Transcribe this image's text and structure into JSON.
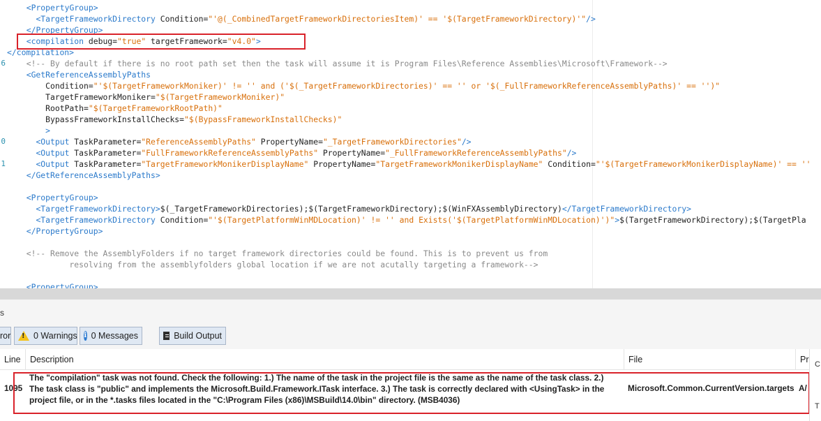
{
  "editor": {
    "gutter_digits": [
      "",
      "",
      "",
      "",
      "",
      "6",
      "",
      "",
      "",
      "",
      "",
      "",
      "0",
      "",
      "1",
      "",
      "",
      "",
      "",
      "",
      "",
      "",
      "",
      "",
      "",
      "",
      ""
    ],
    "lines": [
      [
        {
          "t": "  ",
          "c": "text"
        },
        {
          "t": "<",
          "c": "bracket"
        },
        {
          "t": "PropertyGroup",
          "c": "tag"
        },
        {
          "t": ">",
          "c": "bracket"
        }
      ],
      [
        {
          "t": "    ",
          "c": "text"
        },
        {
          "t": "<",
          "c": "bracket"
        },
        {
          "t": "TargetFrameworkDirectory",
          "c": "tag"
        },
        {
          "t": " Condition",
          "c": "attr"
        },
        {
          "t": "=",
          "c": "eq"
        },
        {
          "t": "\"'@(_CombinedTargetFrameworkDirectoriesItem)' == '$(TargetFrameworkDirectory)'\"",
          "c": "val"
        },
        {
          "t": "/>",
          "c": "bracket"
        }
      ],
      [
        {
          "t": "  ",
          "c": "text"
        },
        {
          "t": "</",
          "c": "bracket"
        },
        {
          "t": "PropertyGroup",
          "c": "tag"
        },
        {
          "t": ">",
          "c": "bracket"
        }
      ],
      [
        {
          "t": "  ",
          "c": "text"
        },
        {
          "t": "<",
          "c": "bracket"
        },
        {
          "t": "compilation",
          "c": "tag"
        },
        {
          "t": " debug",
          "c": "attr"
        },
        {
          "t": "=",
          "c": "eq"
        },
        {
          "t": "\"true\"",
          "c": "val"
        },
        {
          "t": " targetFramework",
          "c": "attr"
        },
        {
          "t": "=",
          "c": "eq"
        },
        {
          "t": "\"v4.0\"",
          "c": "val"
        },
        {
          "t": ">",
          "c": "bracket"
        }
      ],
      [
        {
          "t": "</",
          "c": "bracket"
        },
        {
          "t": "compilation",
          "c": "tag"
        },
        {
          "t": ">",
          "c": "bracket"
        }
      ],
      [
        {
          "t": "  ",
          "c": "text"
        },
        {
          "t": "<!-- By default if there is no root path set then the task will assume it is Program Files\\Reference Assemblies\\Microsoft\\Framework-->",
          "c": "comment"
        }
      ],
      [
        {
          "t": "  ",
          "c": "text"
        },
        {
          "t": "<",
          "c": "bracket"
        },
        {
          "t": "GetReferenceAssemblyPaths",
          "c": "tag"
        }
      ],
      [
        {
          "t": "      Condition",
          "c": "attr"
        },
        {
          "t": "=",
          "c": "eq"
        },
        {
          "t": "\"'$(TargetFrameworkMoniker)' != '' and ('$(_TargetFrameworkDirectories)' == '' or '$(_FullFrameworkReferenceAssemblyPaths)' == '')\"",
          "c": "val"
        }
      ],
      [
        {
          "t": "      TargetFrameworkMoniker",
          "c": "attr"
        },
        {
          "t": "=",
          "c": "eq"
        },
        {
          "t": "\"$(TargetFrameworkMoniker)\"",
          "c": "val"
        }
      ],
      [
        {
          "t": "      RootPath",
          "c": "attr"
        },
        {
          "t": "=",
          "c": "eq"
        },
        {
          "t": "\"$(TargetFrameworkRootPath)\"",
          "c": "val"
        }
      ],
      [
        {
          "t": "      BypassFrameworkInstallChecks",
          "c": "attr"
        },
        {
          "t": "=",
          "c": "eq"
        },
        {
          "t": "\"$(BypassFrameworkInstallChecks)\"",
          "c": "val"
        }
      ],
      [
        {
          "t": "      ",
          "c": "text"
        },
        {
          "t": ">",
          "c": "bracket"
        }
      ],
      [
        {
          "t": "    ",
          "c": "text"
        },
        {
          "t": "<",
          "c": "bracket"
        },
        {
          "t": "Output",
          "c": "tag"
        },
        {
          "t": " TaskParameter",
          "c": "attr"
        },
        {
          "t": "=",
          "c": "eq"
        },
        {
          "t": "\"ReferenceAssemblyPaths\"",
          "c": "val"
        },
        {
          "t": " PropertyName",
          "c": "attr"
        },
        {
          "t": "=",
          "c": "eq"
        },
        {
          "t": "\"_TargetFrameworkDirectories\"",
          "c": "val"
        },
        {
          "t": "/>",
          "c": "bracket"
        }
      ],
      [
        {
          "t": "    ",
          "c": "text"
        },
        {
          "t": "<",
          "c": "bracket"
        },
        {
          "t": "Output",
          "c": "tag"
        },
        {
          "t": " TaskParameter",
          "c": "attr"
        },
        {
          "t": "=",
          "c": "eq"
        },
        {
          "t": "\"FullFrameworkReferenceAssemblyPaths\"",
          "c": "val"
        },
        {
          "t": " PropertyName",
          "c": "attr"
        },
        {
          "t": "=",
          "c": "eq"
        },
        {
          "t": "\"_FullFrameworkReferenceAssemblyPaths\"",
          "c": "val"
        },
        {
          "t": "/>",
          "c": "bracket"
        }
      ],
      [
        {
          "t": "    ",
          "c": "text"
        },
        {
          "t": "<",
          "c": "bracket"
        },
        {
          "t": "Output",
          "c": "tag"
        },
        {
          "t": " TaskParameter",
          "c": "attr"
        },
        {
          "t": "=",
          "c": "eq"
        },
        {
          "t": "\"TargetFrameworkMonikerDisplayName\"",
          "c": "val"
        },
        {
          "t": " PropertyName",
          "c": "attr"
        },
        {
          "t": "=",
          "c": "eq"
        },
        {
          "t": "\"TargetFrameworkMonikerDisplayName\"",
          "c": "val"
        },
        {
          "t": " Condition",
          "c": "attr"
        },
        {
          "t": "=",
          "c": "eq"
        },
        {
          "t": "\"'$(TargetFrameworkMonikerDisplayName)' == ''",
          "c": "val"
        }
      ],
      [
        {
          "t": "  ",
          "c": "text"
        },
        {
          "t": "</",
          "c": "bracket"
        },
        {
          "t": "GetReferenceAssemblyPaths",
          "c": "tag"
        },
        {
          "t": ">",
          "c": "bracket"
        }
      ],
      [
        {
          "t": "",
          "c": "text"
        }
      ],
      [
        {
          "t": "  ",
          "c": "text"
        },
        {
          "t": "<",
          "c": "bracket"
        },
        {
          "t": "PropertyGroup",
          "c": "tag"
        },
        {
          "t": ">",
          "c": "bracket"
        }
      ],
      [
        {
          "t": "    ",
          "c": "text"
        },
        {
          "t": "<",
          "c": "bracket"
        },
        {
          "t": "TargetFrameworkDirectory",
          "c": "tag"
        },
        {
          "t": ">",
          "c": "bracket"
        },
        {
          "t": "$(_TargetFrameworkDirectories);$(TargetFrameworkDirectory);$(WinFXAssemblyDirectory)",
          "c": "text"
        },
        {
          "t": "</",
          "c": "bracket"
        },
        {
          "t": "TargetFrameworkDirectory",
          "c": "tag"
        },
        {
          "t": ">",
          "c": "bracket"
        }
      ],
      [
        {
          "t": "    ",
          "c": "text"
        },
        {
          "t": "<",
          "c": "bracket"
        },
        {
          "t": "TargetFrameworkDirectory",
          "c": "tag"
        },
        {
          "t": " Condition",
          "c": "attr"
        },
        {
          "t": "=",
          "c": "eq"
        },
        {
          "t": "\"'$(TargetPlatformWinMDLocation)' != '' and Exists('$(TargetPlatformWinMDLocation)')\"",
          "c": "val"
        },
        {
          "t": ">",
          "c": "bracket"
        },
        {
          "t": "$(TargetFrameworkDirectory);$(TargetPla",
          "c": "text"
        }
      ],
      [
        {
          "t": "  ",
          "c": "text"
        },
        {
          "t": "</",
          "c": "bracket"
        },
        {
          "t": "PropertyGroup",
          "c": "tag"
        },
        {
          "t": ">",
          "c": "bracket"
        }
      ],
      [
        {
          "t": "",
          "c": "text"
        }
      ],
      [
        {
          "t": "  ",
          "c": "text"
        },
        {
          "t": "<!-- Remove the AssemblyFolders if no target framework directories could be found. This is to prevent us from",
          "c": "comment"
        }
      ],
      [
        {
          "t": "           resolving from the assemblyfolders global location if we are not acutally targeting a framework-->",
          "c": "comment"
        }
      ],
      [
        {
          "t": "",
          "c": "text"
        }
      ],
      [
        {
          "t": "  ",
          "c": "text"
        },
        {
          "t": "<",
          "c": "bracket"
        },
        {
          "t": "PropertyGroup",
          "c": "tag"
        },
        {
          "t": ">",
          "c": "bracket"
        }
      ]
    ]
  },
  "panel": {
    "caption": "s"
  },
  "toolbar": {
    "errors_label": "ror",
    "warnings_label": "0 Warnings",
    "messages_label": "0 Messages",
    "build_output_label": "Build Output",
    "warnings_icon": "warning-icon",
    "messages_icon": "info-icon",
    "output_icon": "output-icon"
  },
  "grid": {
    "columns": {
      "line": "Line",
      "description": "Description",
      "file": "File",
      "project": "Pr"
    },
    "row": {
      "line": "1095",
      "description": "The \"compilation\" task was not found. Check the following: 1.) The name of the task in the project file is the same as the name of the task class. 2.) The task class is \"public\" and implements the Microsoft.Build.Framework.ITask interface. 3.) The task is correctly declared with <UsingTask> in the project file, or in the *.tasks files located in the \"C:\\Program Files (x86)\\MSBuild\\14.0\\bin\" directory. (MSB4036)",
      "file": "Microsoft.Common.CurrentVersion.targets",
      "project": "A/"
    }
  },
  "side": {
    "letter_top": "C",
    "letter_bottom": "T"
  },
  "colors": {
    "highlight": "#d9222a",
    "tag": "#2b7acb",
    "value": "#d86f0a",
    "comment": "#8a8a8a"
  }
}
